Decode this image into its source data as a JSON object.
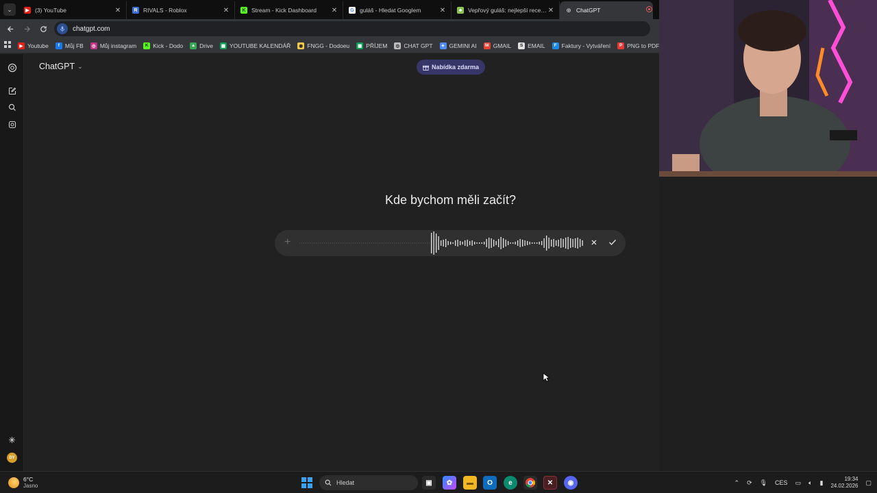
{
  "tabs": [
    {
      "title": "(3) YouTube",
      "fav_color": "#e62117",
      "fav_glyph": "▶",
      "active": false
    },
    {
      "title": "RIVALS - Roblox",
      "fav_color": "#3a6fd8",
      "fav_glyph": "R",
      "active": false
    },
    {
      "title": "Stream - Kick Dashboard",
      "fav_color": "#53fc18",
      "fav_glyph": "K",
      "active": false
    },
    {
      "title": "guláš - Hledat Googlem",
      "fav_color": "#ffffff",
      "fav_glyph": "G",
      "active": false
    },
    {
      "title": "Vepřový guláš: nejlepší recept na",
      "fav_color": "#8bc34a",
      "fav_glyph": "♣",
      "active": false
    },
    {
      "title": "ChatGPT",
      "fav_color": "#d0d0d0",
      "fav_glyph": "◎",
      "active": true
    }
  ],
  "address_bar": {
    "url": "chatgpt.com"
  },
  "bookmarks": [
    {
      "label": "Youtube",
      "color": "#e62117",
      "glyph": "▶"
    },
    {
      "label": "Můj FB",
      "color": "#1877f2",
      "glyph": "f"
    },
    {
      "label": "Můj instagram",
      "color": "#c13584",
      "glyph": "◎"
    },
    {
      "label": "Kick - Dodo",
      "color": "#53fc18",
      "glyph": "K"
    },
    {
      "label": "Drive",
      "color": "#34a853",
      "glyph": "▲"
    },
    {
      "label": "YOUTUBE KALENDÁŘ",
      "color": "#0f9d58",
      "glyph": "▦"
    },
    {
      "label": "FNGG - Dodoeu",
      "color": "#f2c94c",
      "glyph": "◉"
    },
    {
      "label": "PŘÍJEM",
      "color": "#0f9d58",
      "glyph": "▦"
    },
    {
      "label": "CHAT GPT",
      "color": "#bdbdbd",
      "glyph": "◎"
    },
    {
      "label": "GEMINI AI",
      "color": "#4f8cf7",
      "glyph": "✦"
    },
    {
      "label": "GMAIL",
      "color": "#ea4335",
      "glyph": "M"
    },
    {
      "label": "EMAIL",
      "color": "#e0e0e0",
      "glyph": "S"
    },
    {
      "label": "Faktury - Vytváření",
      "color": "#1e88e5",
      "glyph": "F"
    },
    {
      "label": "PNG to PDF",
      "color": "#e53935",
      "glyph": "P"
    },
    {
      "label": "",
      "color": "#e0e0e0",
      "glyph": "S"
    }
  ],
  "chatgpt": {
    "model_label": "ChatGPT",
    "offer_label": "Nabídka zdarma",
    "heading": "Kde bychom měli začít?",
    "avatar_initials": "DY"
  },
  "taskbar": {
    "weather_temp": "6°C",
    "weather_cond": "Jasno",
    "search_placeholder": "Hledat",
    "language": "CES",
    "time": "19:34",
    "date": "24.02.2026"
  },
  "colors": {
    "page_bg": "#212121",
    "composer_bg": "#303030",
    "offer_bg": "#373669",
    "tab_active": "#35363a"
  }
}
